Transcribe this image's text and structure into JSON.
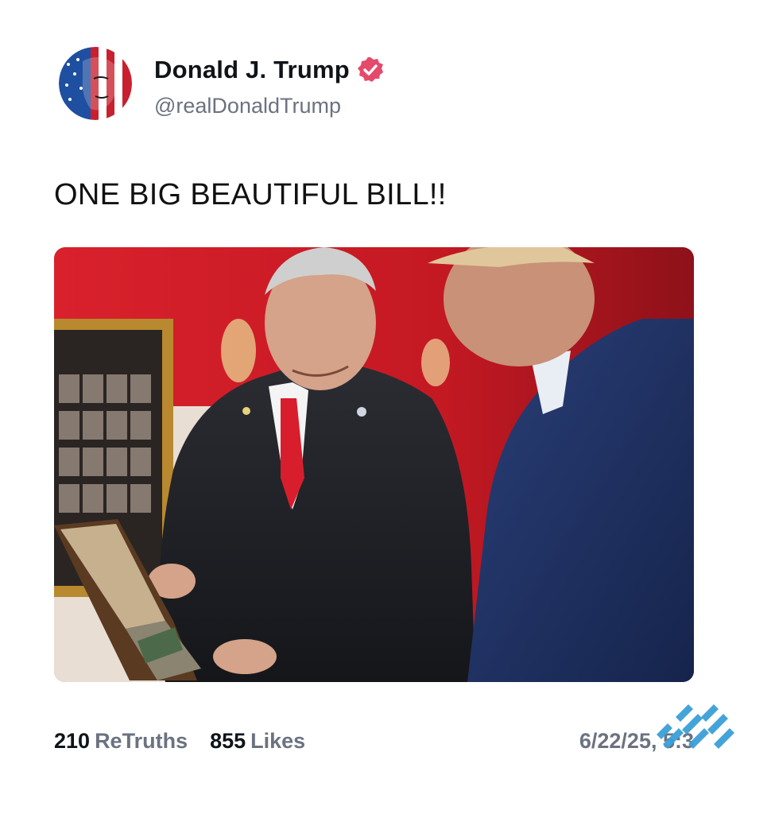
{
  "author": {
    "display_name": "Donald J. Trump",
    "handle": "@realDonaldTrump",
    "verified": true,
    "avatar_icon": "flag-portrait-avatar",
    "verified_icon": "verified-badge-icon"
  },
  "post": {
    "text": "ONE BIG BEAUTIFUL BILL!!"
  },
  "media": {
    "type": "photo"
  },
  "stats": {
    "retruths_count": "210",
    "retruths_label": "ReTruths",
    "likes_count": "855",
    "likes_label": "Likes"
  },
  "timestamp": "6/22/25, 5:3",
  "colors": {
    "verified_badge": "#e54a6b",
    "text_primary": "#0f1419",
    "text_secondary": "#6b7280",
    "watermark": "#3aa0d8"
  },
  "watermark_icon": "logo-watermark-icon"
}
